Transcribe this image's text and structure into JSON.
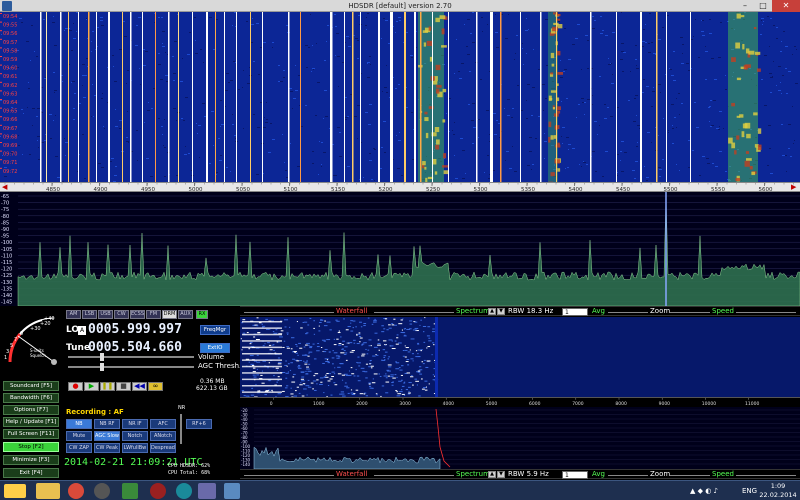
{
  "window": {
    "title": "HDSDR [default]  version 2.70",
    "minimize": "–",
    "maximize": "□",
    "close": "✕"
  },
  "waterfall": {
    "time_labels": [
      "09:54",
      "09:55",
      "09:56",
      "09:57",
      "09:58",
      "09:59",
      "09:60",
      "09:61",
      "09:62",
      "09:63",
      "09:64",
      "09:65",
      "09:66",
      "09:67",
      "09:68",
      "09:69",
      "09:70",
      "09:71",
      "09:72"
    ],
    "freq_labels": [
      "4850",
      "4900",
      "4950",
      "5000",
      "5050",
      "5100",
      "5150",
      "5200",
      "5250",
      "5300",
      "5350",
      "5400",
      "5450",
      "5500",
      "5550",
      "5600"
    ]
  },
  "spectrum": {
    "db_labels": [
      "-65",
      "-70",
      "-75",
      "-80",
      "-85",
      "-90",
      "-95",
      "-100",
      "-105",
      "-110",
      "-115",
      "-120",
      "-125",
      "-130",
      "-135",
      "-140",
      "-145"
    ]
  },
  "smeter": {
    "scale": [
      "+20",
      "+30",
      "+40",
      "9",
      "7",
      "5",
      "3",
      "1"
    ],
    "unit_top": "S-units",
    "unit_bottom": "Squelch"
  },
  "lo": {
    "label": "LO",
    "badge": "A",
    "value": "0005.999.997",
    "freqmgr": "FreqMgr"
  },
  "tune": {
    "label": "Tune",
    "value": "0005.504.660",
    "extio": "ExtIO"
  },
  "sliders": {
    "volume": "Volume",
    "agc": "AGC Thresh."
  },
  "modes": [
    "AM",
    "LSB",
    "USB",
    "CW",
    "ECSS",
    "FM",
    "DRM",
    "AUX"
  ],
  "modes_row2": [
    "RX",
    "",
    "",
    "USB",
    "",
    "CW",
    ""
  ],
  "recording": {
    "size_top": "0.36 MB",
    "size_bottom": "622.13 GB",
    "label": "Recording : AF",
    "nr": "NR"
  },
  "transport": [
    "●",
    "▶",
    "❚❚",
    "■",
    "◀◀",
    "∞"
  ],
  "dsp": {
    "row1": [
      "NB",
      "NB RF",
      "NR IF",
      "AFC",
      "RF+6"
    ],
    "row2": [
      "Mute",
      "AGC Slow",
      "Notch",
      "ANotch"
    ],
    "row3": [
      "CW ZAP",
      "CW Peak",
      "LWfullBw",
      "Despread"
    ]
  },
  "status": {
    "datetime": "2014-02-21  21:09:21 UTC",
    "cpu_hdsdr": "CPU HDSDR: 62%",
    "cpu_total": "CPU Total: 68%"
  },
  "function_buttons": [
    {
      "label": "Soundcard  [F5]",
      "on": false
    },
    {
      "label": "Bandwidth  [F6]",
      "on": false
    },
    {
      "label": "Options  [F7]",
      "on": false
    },
    {
      "label": "Help / Update  [F1]",
      "on": false
    },
    {
      "label": "Full Screen  [F11]",
      "on": false
    },
    {
      "label": "Stop  [F2]",
      "on": true
    },
    {
      "label": "Minimize  [F3]",
      "on": false
    },
    {
      "label": "Exit  [F4]",
      "on": false
    }
  ],
  "small_panel": {
    "waterfall_label": "Waterfall",
    "spectrum_label": "Spectrum",
    "rbw_top": "RBW 18.3 Hz",
    "rbw_bottom": "RBW  5.9 Hz",
    "avg": "Avg",
    "avg_value": "1",
    "zoom": "Zoom",
    "speed": "Speed",
    "freq_labels": [
      "0",
      "1000",
      "2000",
      "3000",
      "4000",
      "5000",
      "6000",
      "7000",
      "8000",
      "9000",
      "10000",
      "11000"
    ],
    "db_labels": [
      "-20",
      "-30",
      "-40",
      "-50",
      "-60",
      "-70",
      "-80",
      "-90",
      "-100",
      "-110",
      "-120",
      "-130",
      "-140"
    ]
  },
  "taskbar": {
    "lang": "ENG",
    "time": "1:09",
    "date": "22.02.2014"
  },
  "colors": {
    "waterfall_bg": "#0a1e8a",
    "spectrum_fill": "#2e6f4f",
    "spectrum_line": "#a0e8a0",
    "accent_green": "#55ff55",
    "accent_red": "#ff5050"
  }
}
